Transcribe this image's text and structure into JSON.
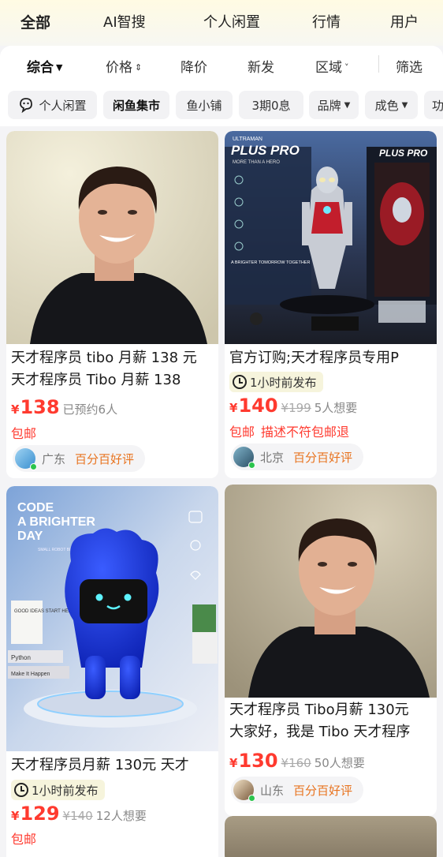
{
  "top_tabs": [
    {
      "label": "全部",
      "active": true
    },
    {
      "label": "AI智搜",
      "active": false
    },
    {
      "label": "个人闲置",
      "active": false
    },
    {
      "label": "行情",
      "active": false
    },
    {
      "label": "用户",
      "active": false
    }
  ],
  "sort_bar": {
    "items": [
      "综合",
      "价格",
      "降价",
      "新发",
      "区域"
    ],
    "filter": "筛选"
  },
  "chips": [
    "个人闲置",
    "闲鱼集市",
    "鱼小铺",
    "3期0息",
    "品牌",
    "成色",
    "功"
  ],
  "colors": {
    "accent": "#ffe34a",
    "price": "#ff3a2f",
    "rating": "#e8731f",
    "online": "#2bc44d"
  },
  "products": [
    {
      "title_lines": [
        "天才程序员 tibo 月薪 138 元",
        "天才程序员 Tibo 月薪 138"
      ],
      "price": "138",
      "original_price": "",
      "meta": "已预约6人",
      "tags": [
        "包邮"
      ],
      "time_badge": "",
      "location": "广东",
      "rating": "百分百好评",
      "image": "portrait-man"
    },
    {
      "title_lines": [
        "官方订购;天才程序员专用P"
      ],
      "price": "140",
      "original_price": "¥199",
      "meta": "5人想要",
      "tags": [
        "包邮",
        "描述不符包邮退"
      ],
      "time_badge": "1小时前发布",
      "location": "北京",
      "rating": "百分百好评",
      "image": "ultraman-figure",
      "image_text": {
        "brand": "ULTRAMAN",
        "product": "PLUS PRO",
        "tagline": "MORE THAN A HERO",
        "slogan": "A BRIGHTER TOMORROW TOGETHER"
      }
    },
    {
      "title_lines": [
        "天才程序员月薪 130元 天才"
      ],
      "price": "129",
      "original_price": "¥140",
      "meta": "12人想要",
      "tags": [
        "包邮"
      ],
      "time_badge": "1小时前发布",
      "location": "",
      "rating": "",
      "image": "blue-robot",
      "image_text": {
        "headline_1": "CODE",
        "headline_2": "A BRIGHTER",
        "headline_3": "DAY",
        "sub": "SMALL ROBOT BIG IDEAS",
        "note": "GOOD IDEAS START HERE",
        "book_1": "Python",
        "book_2": "Make It Happen"
      }
    },
    {
      "title_lines": [
        "天才程序员 Tibo月薪 130元",
        "大家好，我是 Tibo 天才程序"
      ],
      "price": "130",
      "original_price": "¥160",
      "meta": "50人想要",
      "tags": [],
      "time_badge": "",
      "location": "山东",
      "rating": "百分百好评",
      "image": "portrait-man"
    }
  ]
}
